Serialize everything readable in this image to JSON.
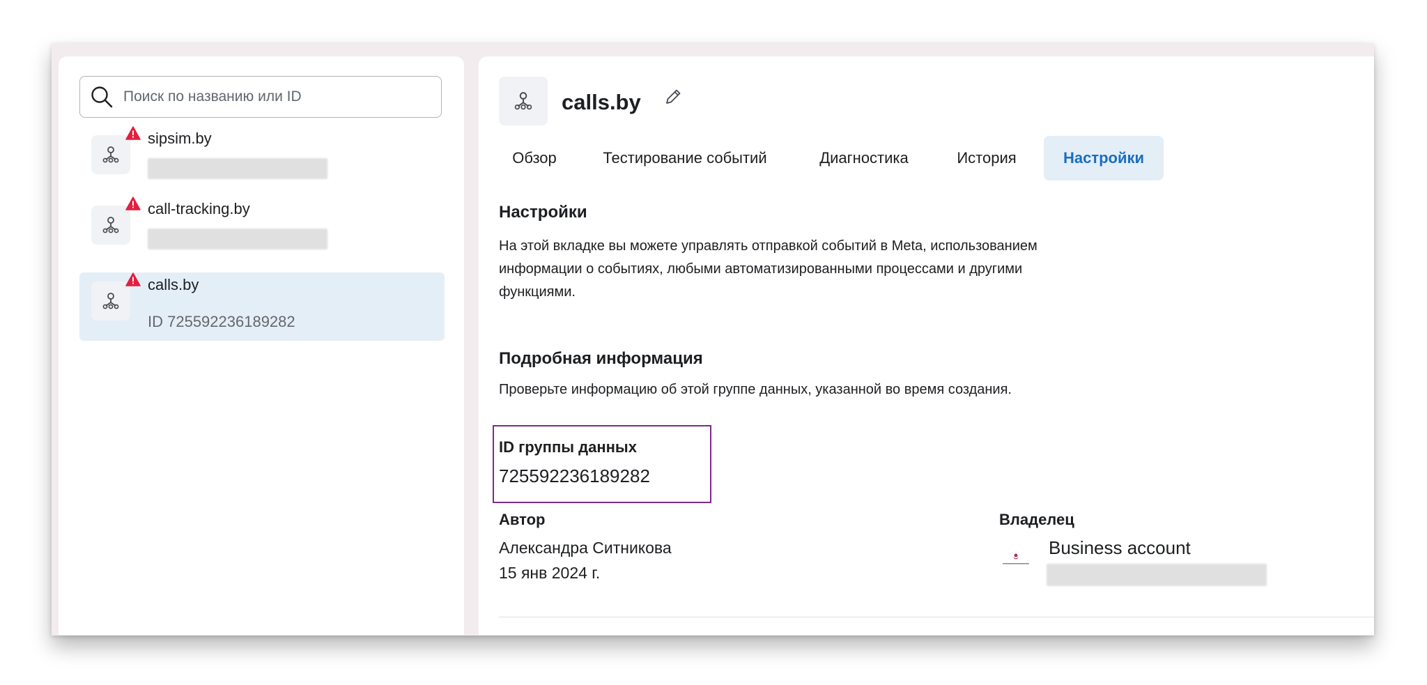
{
  "sidebar": {
    "search": {
      "placeholder": "Поиск по названию или ID",
      "value": ""
    },
    "datasets": [
      {
        "name": "sipsim.by",
        "warning": true
      },
      {
        "name": "call-tracking.by",
        "warning": true
      },
      {
        "name": "calls.by",
        "id_label": "ID 725592236189282",
        "warning": true,
        "selected": true
      }
    ]
  },
  "header": {
    "title": "calls.by"
  },
  "tabs": [
    {
      "label": "Обзор"
    },
    {
      "label": "Тестирование событий"
    },
    {
      "label": "Диагностика"
    },
    {
      "label": "История"
    },
    {
      "label": "Настройки",
      "active": true
    }
  ],
  "settings": {
    "title": "Настройки",
    "description_lines": [
      "На этой вкладке вы можете управлять отправкой событий в Meta, использованием",
      "информации о событиях, любыми автоматизированными процессами и другими",
      "функциями."
    ]
  },
  "details": {
    "title": "Подробная информация",
    "description": "Проверьте информацию об этой группе данных, указанной во время создания.",
    "dataset_id_label": "ID группы данных",
    "dataset_id_value": "725592236189282",
    "author_label": "Автор",
    "author_name": "Александра Ситникова",
    "author_date": "15 янв 2024 г.",
    "owner_label": "Владелец",
    "owner_name": "Business account"
  },
  "colors": {
    "accent": "#1a6ec1",
    "selected_bg": "#e4eef7",
    "warning": "#e41e3f",
    "highlight_border": "#7d2a8b"
  }
}
